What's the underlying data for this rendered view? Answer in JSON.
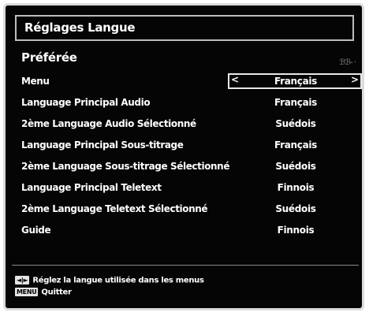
{
  "title": "Réglages Langue",
  "section": "Préférée",
  "corner_icon": "ℬℬ- ·",
  "rows": [
    {
      "label": "Menu",
      "value": "Français"
    },
    {
      "label": "Language Principal Audio",
      "value": "Français"
    },
    {
      "label": "2ème Language Audio Sélectionné",
      "value": "Suédois"
    },
    {
      "label": "Language Principal Sous-titrage",
      "value": "Français"
    },
    {
      "label": "2ème Language Sous-titrage Sélectionné",
      "value": "Suédois"
    },
    {
      "label": "Language Principal Teletext",
      "value": "Finnois"
    },
    {
      "label": "2ème Language Teletext Sélectionné",
      "value": "Suédois"
    },
    {
      "label": "Guide",
      "value": "Finnois"
    }
  ],
  "selector": {
    "left_arrow": "<",
    "right_arrow": ">"
  },
  "footer": {
    "hint1_key": "◄|►",
    "hint1_text": "Réglez la langue utilisée dans les menus",
    "hint2_key": "MENU",
    "hint2_text": "Quitter"
  }
}
